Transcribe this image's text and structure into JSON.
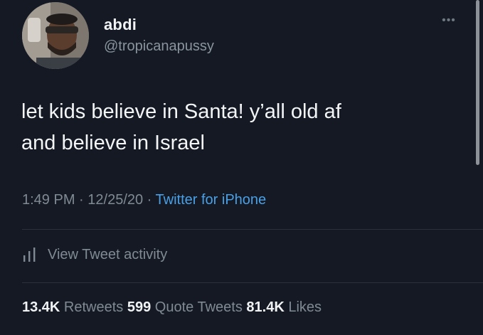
{
  "author": {
    "display_name": "abdi",
    "handle": "@tropicanapussy"
  },
  "icons": {
    "avatar": "avatar-photo",
    "more": "more-horizontal-icon",
    "activity": "bar-chart-icon"
  },
  "tweet": {
    "text": "let kids believe in Santa! y’all old af\nand believe in Israel",
    "time": "1:49 PM",
    "separator1": " · ",
    "date": "12/25/20",
    "separator2": " · ",
    "source": "Twitter for iPhone"
  },
  "activity": {
    "label": "View Tweet activity"
  },
  "stats": {
    "retweets_count": "13.4K",
    "retweets_label": " Retweets",
    "quotes_count": "599",
    "quotes_label": " Quote Tweets",
    "likes_count": "81.4K",
    "likes_label": " Likes"
  },
  "colors": {
    "background": "#141923",
    "link": "#4aa0e6",
    "muted": "#808a94",
    "text": "#f3f5f7"
  }
}
